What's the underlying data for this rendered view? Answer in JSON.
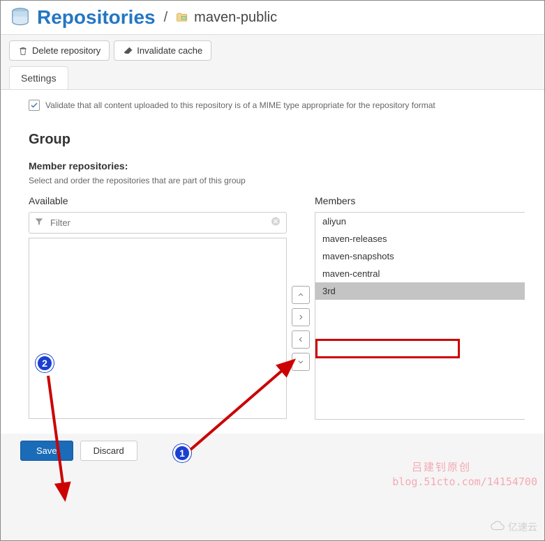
{
  "header": {
    "title": "Repositories",
    "breadcrumb_sep": "/",
    "repo_name": "maven-public"
  },
  "toolbar": {
    "delete_label": "Delete repository",
    "invalidate_label": "Invalidate cache"
  },
  "tabs": {
    "settings": "Settings"
  },
  "validate": {
    "label": "Validate that all content uploaded to this repository is of a MIME type appropriate for the repository format"
  },
  "group": {
    "section_title": "Group",
    "field_label": "Member repositories:",
    "field_help": "Select and order the repositories that are part of this group",
    "available_title": "Available",
    "members_title": "Members",
    "filter_placeholder": "Filter",
    "members": [
      {
        "label": "aliyun",
        "selected": false
      },
      {
        "label": "maven-releases",
        "selected": false
      },
      {
        "label": "maven-snapshots",
        "selected": false
      },
      {
        "label": "maven-central",
        "selected": false
      },
      {
        "label": "3rd",
        "selected": true
      }
    ]
  },
  "footer": {
    "save": "Save",
    "discard": "Discard"
  },
  "annotations": {
    "badge1": "1",
    "badge2": "2",
    "watermark1": "吕建钊原创",
    "watermark2": "blog.51cto.com/14154700",
    "logo_text": "亿速云"
  }
}
